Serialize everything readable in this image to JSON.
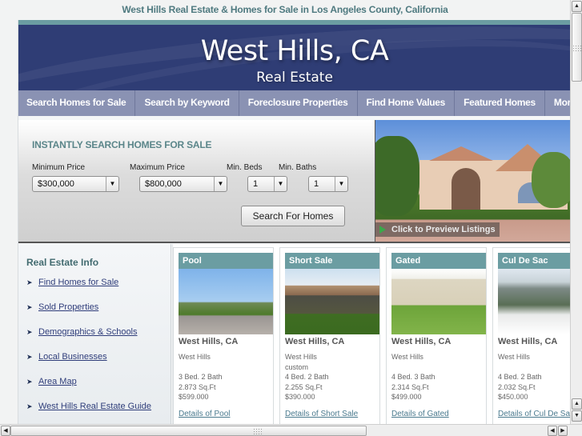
{
  "page_heading": "West Hills Real Estate & Homes for Sale in Los Angeles County, California",
  "banner": {
    "title": "West Hills, CA",
    "subtitle": "Real Estate"
  },
  "nav": {
    "items": [
      {
        "label": "Search Homes for Sale"
      },
      {
        "label": "Search by Keyword"
      },
      {
        "label": "Foreclosure Properties"
      },
      {
        "label": "Find Home Values"
      },
      {
        "label": "Featured Homes"
      },
      {
        "label": "Mortgage"
      }
    ]
  },
  "search": {
    "heading": "INSTANTLY SEARCH HOMES FOR SALE",
    "min_price": {
      "label": "Minimum Price",
      "value": "$300,000"
    },
    "max_price": {
      "label": "Maximum Price",
      "value": "$800,000"
    },
    "min_beds": {
      "label": "Min. Beds",
      "value": "1"
    },
    "min_baths": {
      "label": "Min. Baths",
      "value": "1"
    },
    "button_label": "Search For Homes"
  },
  "hero": {
    "caption": "Click to Preview Listings"
  },
  "sidebar": {
    "heading": "Real Estate Info",
    "links": [
      {
        "label": "Find Homes for Sale"
      },
      {
        "label": "Sold Properties"
      },
      {
        "label": "Demographics & Schools"
      },
      {
        "label": "Local Businesses"
      },
      {
        "label": "Area Map"
      },
      {
        "label": "West Hills Real Estate Guide"
      }
    ]
  },
  "listings": [
    {
      "category": "Pool",
      "city": "West Hills, CA",
      "info": "West Hills\n\n3 Bed. 2 Bath\n2.873 Sq.Ft\n$599.000",
      "details": "Details of Pool"
    },
    {
      "category": "Short Sale",
      "city": "West Hills, CA",
      "info": "West Hills\ncustom\n4 Bed. 2 Bath\n2.255 Sq.Ft\n$390.000",
      "details": "Details of Short Sale"
    },
    {
      "category": "Gated",
      "city": "West Hills, CA",
      "info": "West Hills\n\n4 Bed. 3 Bath\n2.314 Sq.Ft\n$499.000",
      "details": "Details of Gated"
    },
    {
      "category": "Cul De Sac",
      "city": "West Hills, CA",
      "info": "West Hills\n\n4 Bed. 2 Bath\n2.032 Sq.Ft\n$450.000",
      "details": "Details of Cul De Sac"
    }
  ],
  "icons": {
    "dropdown": "▼",
    "bullet": "➤",
    "scroll_up": "▲",
    "scroll_down": "▼",
    "scroll_left": "◀",
    "scroll_right": "▶"
  },
  "colors": {
    "banner": "#2f3d75",
    "accent_teal": "#6b9da2",
    "nav": "#8a92b3",
    "link": "#2f3d7a"
  }
}
